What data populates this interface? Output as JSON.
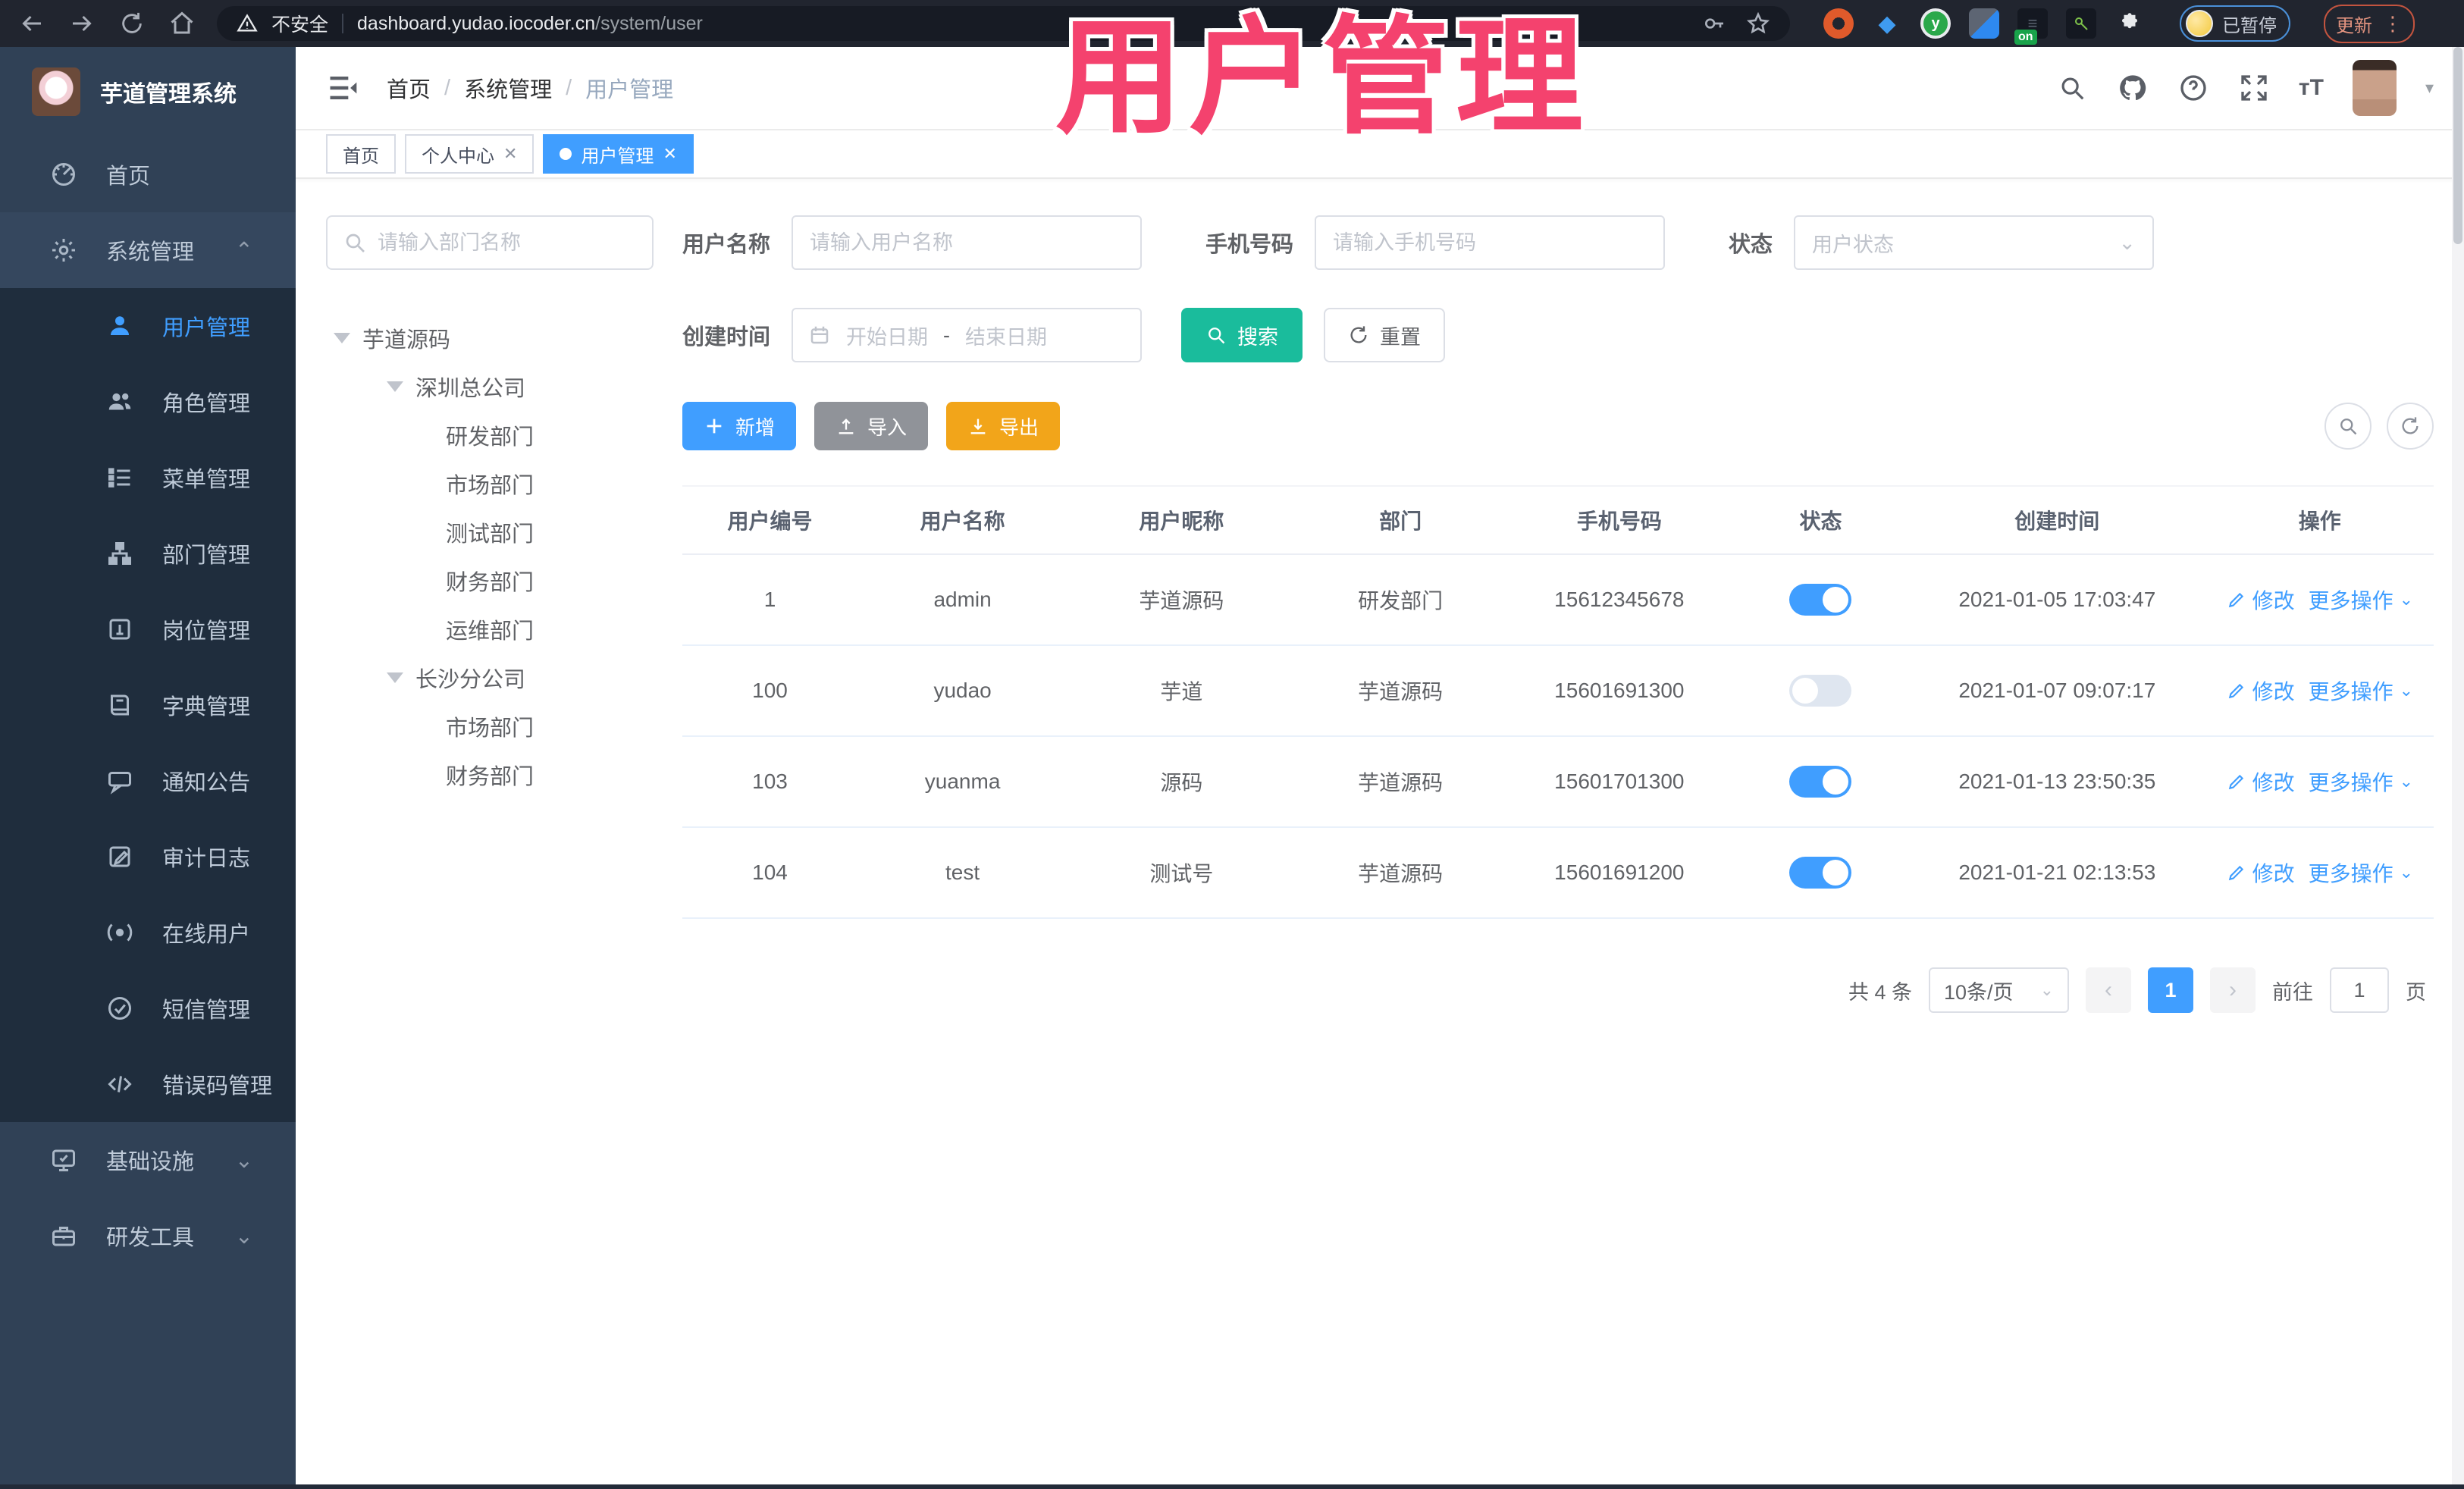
{
  "chrome": {
    "warning_label": "不安全",
    "url_host": "dashboard.yudao.iocoder.cn",
    "url_path": "/system/user",
    "ext_on_badge": "on",
    "paused_badge": "已暂停",
    "update_button": "更新"
  },
  "overlay": {
    "title": "用户管理",
    "color": "#f4426e"
  },
  "sidebar": {
    "app_title": "芋道管理系统",
    "home": "首页",
    "system": "系统管理",
    "submenu": [
      "用户管理",
      "角色管理",
      "菜单管理",
      "部门管理",
      "岗位管理",
      "字典管理",
      "通知公告",
      "审计日志",
      "在线用户",
      "短信管理",
      "错误码管理"
    ],
    "infra": "基础设施",
    "devtools": "研发工具"
  },
  "navbar": {
    "breadcrumb": [
      "首页",
      "系统管理",
      "用户管理"
    ]
  },
  "tabs": [
    {
      "label": "首页"
    },
    {
      "label": "个人中心"
    },
    {
      "label": "用户管理"
    }
  ],
  "dept_tree": {
    "search_placeholder": "请输入部门名称",
    "root": "芋道源码",
    "branches": [
      {
        "label": "深圳总公司",
        "children": [
          "研发部门",
          "市场部门",
          "测试部门",
          "财务部门",
          "运维部门"
        ]
      },
      {
        "label": "长沙分公司",
        "children": [
          "市场部门",
          "财务部门"
        ]
      }
    ]
  },
  "filters": {
    "username_label": "用户名称",
    "username_placeholder": "请输入用户名称",
    "mobile_label": "手机号码",
    "mobile_placeholder": "请输入手机号码",
    "status_label": "状态",
    "status_placeholder": "用户状态",
    "created_label": "创建时间",
    "date_start": "开始日期",
    "date_separator": "-",
    "date_end": "结束日期",
    "search_button": "搜索",
    "reset_button": "重置"
  },
  "toolbar": {
    "add_button": "新增",
    "import_button": "导入",
    "export_button": "导出"
  },
  "table": {
    "columns": [
      "用户编号",
      "用户名称",
      "用户昵称",
      "部门",
      "手机号码",
      "状态",
      "创建时间",
      "操作"
    ],
    "edit_action": "修改",
    "more_action": "更多操作",
    "rows": [
      {
        "id": "1",
        "username": "admin",
        "nickname": "芋道源码",
        "dept": "研发部门",
        "mobile": "15612345678",
        "status": true,
        "created": "2021-01-05 17:03:47"
      },
      {
        "id": "100",
        "username": "yudao",
        "nickname": "芋道",
        "dept": "芋道源码",
        "mobile": "15601691300",
        "status": false,
        "created": "2021-01-07 09:07:17"
      },
      {
        "id": "103",
        "username": "yuanma",
        "nickname": "源码",
        "dept": "芋道源码",
        "mobile": "15601701300",
        "status": true,
        "created": "2021-01-13 23:50:35"
      },
      {
        "id": "104",
        "username": "test",
        "nickname": "测试号",
        "dept": "芋道源码",
        "mobile": "15601691200",
        "status": true,
        "created": "2021-01-21 02:13:53"
      }
    ]
  },
  "pagination": {
    "total_label": "共 4 条",
    "page_size": "10条/页",
    "current_page": "1",
    "goto_label": "前往",
    "goto_value": "1",
    "page_unit": "页"
  },
  "colors": {
    "accent": "#409eff",
    "search_button": "#1abc9c",
    "export_button": "#f2a51a",
    "import_button": "#909399",
    "overlay_pink": "#f4426e",
    "sidebar_bg": "#304156",
    "submenu_bg": "#1f2d3d"
  }
}
